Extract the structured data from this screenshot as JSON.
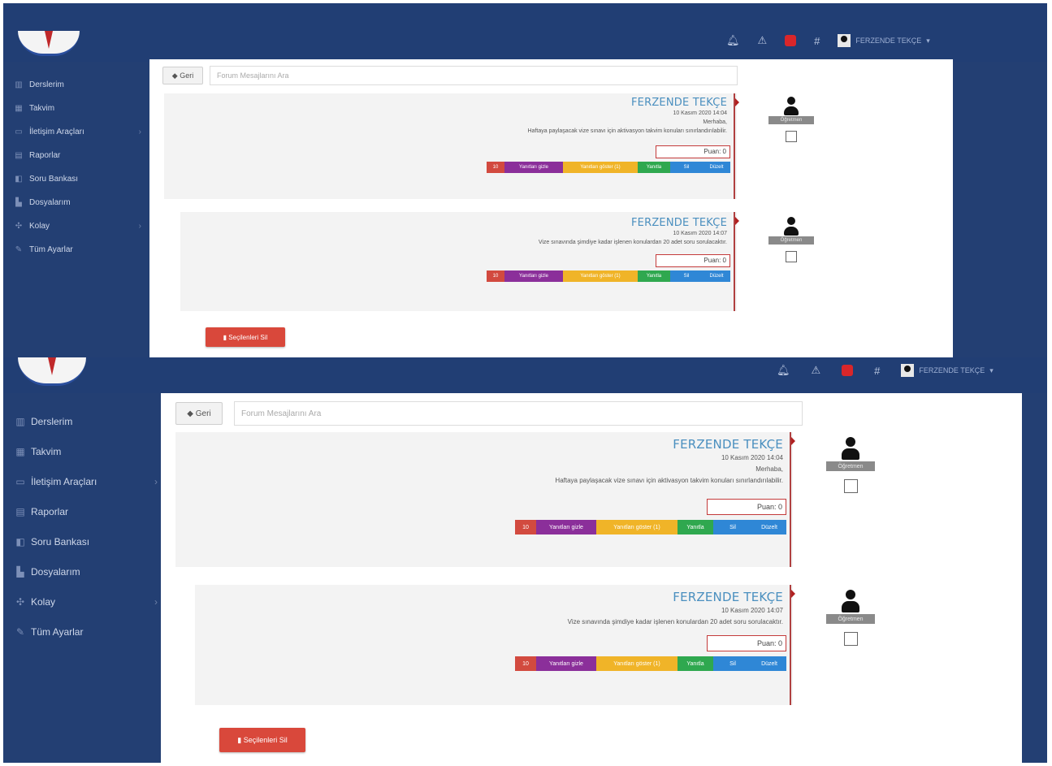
{
  "header": {
    "user_name": "FERZENDE TEKÇE",
    "icons": [
      "bell-icon",
      "warning-icon",
      "flag-icon",
      "grid-icon",
      "user-icon"
    ]
  },
  "sidebar": {
    "items": [
      {
        "label": "Derslerim",
        "icon": "book-icon",
        "has_children": false
      },
      {
        "label": "Takvim",
        "icon": "calendar-icon",
        "has_children": false
      },
      {
        "label": "İletişim Araçları",
        "icon": "chat-icon",
        "has_children": true
      },
      {
        "label": "Raporlar",
        "icon": "report-icon",
        "has_children": false
      },
      {
        "label": "Soru Bankası",
        "icon": "question-bank-icon",
        "has_children": false
      },
      {
        "label": "Dosyalarım",
        "icon": "folder-icon",
        "has_children": false
      },
      {
        "label": "Kolay",
        "icon": "tools-icon",
        "has_children": true
      },
      {
        "label": "Tüm Ayarlar",
        "icon": "wrench-icon",
        "has_children": false
      }
    ]
  },
  "toolbar": {
    "back_label": "Geri",
    "search_placeholder": "Forum Mesajlarını Ara"
  },
  "messages": [
    {
      "author": "FERZENDE TEKÇE",
      "date": "10 Kasım 2020 14:04",
      "greeting": "Merhaba,",
      "body": "Haftaya paylaşacak vize sınavı için aktivasyon takvim konuları sınırlandırılabilir.",
      "score_label": "Puan: 0",
      "user_tag": "Öğretmen",
      "buttons": [
        "10",
        "Yanıtları gizle",
        "Yanıtları göster (1)",
        "Yanıtla",
        "Sil",
        "Düzelt"
      ]
    },
    {
      "author": "FERZENDE TEKÇE",
      "date": "10 Kasım 2020 14:07",
      "greeting": "",
      "body": "Vize sınavında şimdiye kadar işlenen konulardan 20 adet soru sorulacaktır.",
      "score_label": "Puan: 0",
      "user_tag": "Öğretmen",
      "buttons": [
        "10",
        "Yanıtları gizle",
        "Yanıtları göster (1)",
        "Yanıtla",
        "Sil",
        "Düzelt"
      ]
    }
  ],
  "delete_selected_label": "Seçilenleri Sil",
  "colors": {
    "frame": "#233f73",
    "accent_red": "#d9483b",
    "author_blue": "#4a8fbf"
  }
}
